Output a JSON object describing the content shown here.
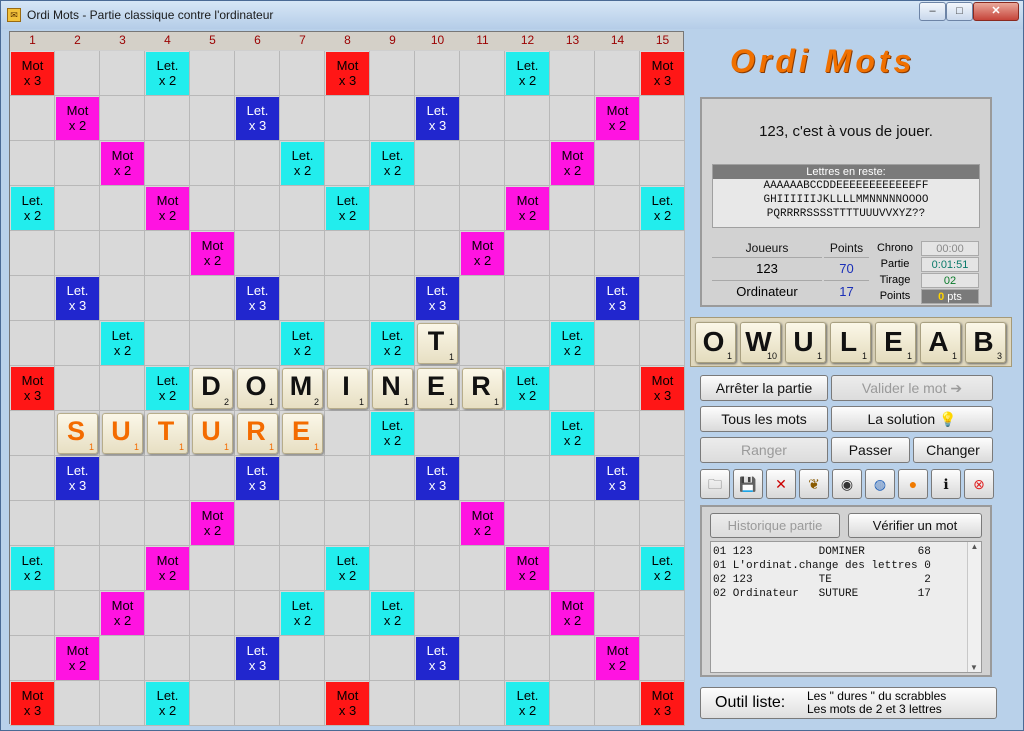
{
  "window": {
    "title": "Ordi Mots - Partie classique contre l'ordinateur",
    "minimize": "–",
    "maximize": "□",
    "close": "✕"
  },
  "board": {
    "columns": [
      "1",
      "2",
      "3",
      "4",
      "5",
      "6",
      "7",
      "8",
      "9",
      "10",
      "11",
      "12",
      "13",
      "14",
      "15"
    ],
    "premium_labels": {
      "tw": [
        "Mot",
        "x 3"
      ],
      "dw": [
        "Mot",
        "x 2"
      ],
      "tl": [
        "Let.",
        "x 3"
      ],
      "dl": [
        "Let.",
        "x 2"
      ]
    },
    "premium": {
      "tw": [
        [
          0,
          0
        ],
        [
          0,
          7
        ],
        [
          0,
          14
        ],
        [
          7,
          0
        ],
        [
          7,
          14
        ],
        [
          14,
          0
        ],
        [
          14,
          7
        ],
        [
          14,
          14
        ]
      ],
      "dw": [
        [
          1,
          1
        ],
        [
          1,
          13
        ],
        [
          2,
          2
        ],
        [
          2,
          12
        ],
        [
          3,
          3
        ],
        [
          3,
          11
        ],
        [
          4,
          4
        ],
        [
          4,
          10
        ],
        [
          10,
          4
        ],
        [
          10,
          10
        ],
        [
          11,
          3
        ],
        [
          11,
          11
        ],
        [
          12,
          2
        ],
        [
          12,
          12
        ],
        [
          13,
          1
        ],
        [
          13,
          13
        ]
      ],
      "tl": [
        [
          1,
          5
        ],
        [
          1,
          9
        ],
        [
          5,
          1
        ],
        [
          5,
          5
        ],
        [
          5,
          9
        ],
        [
          5,
          13
        ],
        [
          9,
          1
        ],
        [
          9,
          5
        ],
        [
          9,
          9
        ],
        [
          9,
          13
        ],
        [
          13,
          5
        ],
        [
          13,
          9
        ]
      ],
      "dl": [
        [
          0,
          3
        ],
        [
          0,
          11
        ],
        [
          2,
          6
        ],
        [
          2,
          8
        ],
        [
          3,
          0
        ],
        [
          3,
          7
        ],
        [
          3,
          14
        ],
        [
          6,
          2
        ],
        [
          6,
          6
        ],
        [
          6,
          8
        ],
        [
          6,
          12
        ],
        [
          7,
          3
        ],
        [
          7,
          11
        ],
        [
          8,
          2
        ],
        [
          8,
          8
        ],
        [
          8,
          12
        ],
        [
          11,
          0
        ],
        [
          11,
          7
        ],
        [
          11,
          14
        ],
        [
          12,
          6
        ],
        [
          12,
          8
        ],
        [
          14,
          3
        ],
        [
          14,
          11
        ]
      ]
    },
    "tiles": [
      {
        "row": 6,
        "col": 9,
        "letter": "T",
        "points": "1",
        "color": "normal"
      },
      {
        "row": 7,
        "col": 4,
        "letter": "D",
        "points": "2",
        "color": "normal"
      },
      {
        "row": 7,
        "col": 5,
        "letter": "O",
        "points": "1",
        "color": "normal"
      },
      {
        "row": 7,
        "col": 6,
        "letter": "M",
        "points": "2",
        "color": "normal"
      },
      {
        "row": 7,
        "col": 7,
        "letter": "I",
        "points": "1",
        "color": "normal"
      },
      {
        "row": 7,
        "col": 8,
        "letter": "N",
        "points": "1",
        "color": "normal"
      },
      {
        "row": 7,
        "col": 9,
        "letter": "E",
        "points": "1",
        "color": "normal"
      },
      {
        "row": 7,
        "col": 10,
        "letter": "R",
        "points": "1",
        "color": "normal"
      },
      {
        "row": 8,
        "col": 1,
        "letter": "S",
        "points": "1",
        "color": "orange"
      },
      {
        "row": 8,
        "col": 2,
        "letter": "U",
        "points": "1",
        "color": "orange"
      },
      {
        "row": 8,
        "col": 3,
        "letter": "T",
        "points": "1",
        "color": "orange"
      },
      {
        "row": 8,
        "col": 4,
        "letter": "U",
        "points": "1",
        "color": "orange"
      },
      {
        "row": 8,
        "col": 5,
        "letter": "R",
        "points": "1",
        "color": "orange"
      },
      {
        "row": 8,
        "col": 6,
        "letter": "E",
        "points": "1",
        "color": "orange"
      }
    ]
  },
  "logo": "Ordi Mots",
  "info": {
    "message": "123, c'est à vous de jouer.",
    "remaining_title": "Lettres en reste:",
    "remaining_lines": [
      "AAAAAABCCDDEEEEEEEEEEEEFF",
      "GHIIIIIIJKLLLLMMNNNNNOOOO",
      "PQRRRRSSSSTTTTUUUVVXYZ??"
    ],
    "players_header": "Joueurs",
    "points_header": "Points",
    "players": [
      {
        "name": "123",
        "points": "70"
      },
      {
        "name": "Ordinateur",
        "points": "17"
      }
    ],
    "chrono": {
      "label_chrono": "Chrono",
      "chrono": "00:00",
      "label_partie": "Partie",
      "partie": "0:01:51",
      "label_tirage": "Tirage",
      "tirage": "02",
      "label_points": "Points",
      "points": "0",
      "points_unit": "pts"
    }
  },
  "rack": [
    {
      "letter": "O",
      "points": "1"
    },
    {
      "letter": "W",
      "points": "10"
    },
    {
      "letter": "U",
      "points": "1"
    },
    {
      "letter": "L",
      "points": "1"
    },
    {
      "letter": "E",
      "points": "1"
    },
    {
      "letter": "A",
      "points": "1"
    },
    {
      "letter": "B",
      "points": "3"
    }
  ],
  "buttons": {
    "stop": "Arrêter la partie",
    "validate": "Valider le mot ➔",
    "all_words": "Tous les mots",
    "solution": "La  solution  💡",
    "arrange": "Ranger",
    "pass": "Passer",
    "change": "Changer"
  },
  "icons": [
    {
      "name": "open-folder-icon",
      "glyph": "🗀"
    },
    {
      "name": "save-icon",
      "glyph": "💾"
    },
    {
      "name": "delete-icon",
      "glyph": "✕"
    },
    {
      "name": "laurel-icon",
      "glyph": "❦"
    },
    {
      "name": "speaker-icon",
      "glyph": "◉"
    },
    {
      "name": "blue-sphere-icon",
      "glyph": "◍"
    },
    {
      "name": "orange-ball-icon",
      "glyph": "●"
    },
    {
      "name": "info-icon",
      "glyph": "ℹ"
    },
    {
      "name": "exit-icon",
      "glyph": "⊗"
    }
  ],
  "history": {
    "tab_history": "Historique partie",
    "tab_verify": "Vérifier un mot",
    "rows": [
      "01 123          DOMINER        68",
      "01 L'ordinat.change des lettres 0",
      "02 123          TE              2",
      "02 Ordinateur   SUTURE         17"
    ]
  },
  "tools": {
    "label": "Outil liste:",
    "line1": "Les \" dures \" du scrabbles",
    "line2": "Les  mots de 2 et 3 lettres"
  }
}
